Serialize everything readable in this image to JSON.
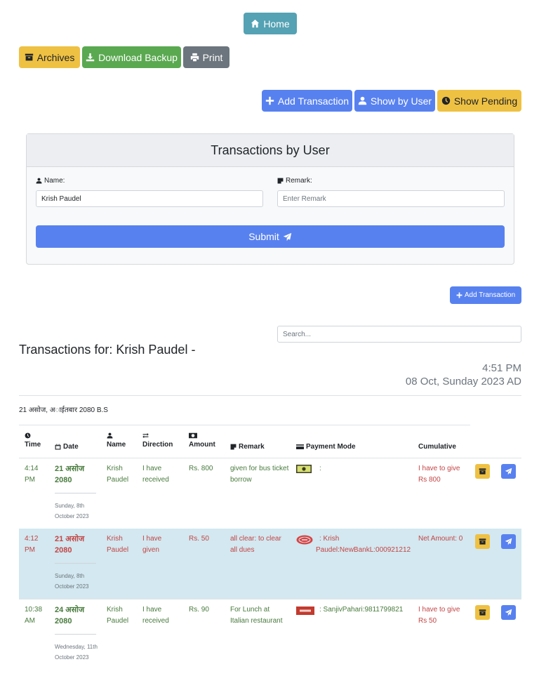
{
  "nav": {
    "home_label": "Home"
  },
  "toolbar": {
    "archives_label": "Archives",
    "download_label": "Download Backup",
    "print_label": "Print"
  },
  "actions": {
    "add_transaction_label": "Add Transaction",
    "show_by_user_label": "Show by User",
    "show_pending_label": "Show Pending"
  },
  "filter_form": {
    "title": "Transactions by User",
    "name_label": "Name:",
    "name_value": "Krish Paudel",
    "remark_label": "Remark:",
    "remark_placeholder": "Enter Remark",
    "submit_label": "Submit"
  },
  "small_add_transaction_label": "Add Transaction",
  "search": {
    "placeholder": "Search..."
  },
  "transactions_heading": "Transactions for: Krish Paudel -",
  "clock": {
    "time": "4:51 PM",
    "date": "08 Oct, Sunday 2023 AD"
  },
  "nepali_date": "21 असोज, अाईतबार 2080 B.S",
  "table": {
    "headers": {
      "time": "Time",
      "date": "Date",
      "name": "Name",
      "direction": "Direction",
      "amount": "Amount",
      "remark": "Remark",
      "payment_mode": "Payment Mode",
      "cumulative": "Cumulative"
    },
    "rows": [
      {
        "time": "4:14 PM",
        "date_np": "21 असोज 2080",
        "date_en": "Sunday, 8th October 2023",
        "name": "Krish Paudel",
        "direction": "I have received",
        "amount": "Rs. 800",
        "remark": "given for bus ticket borrow",
        "payment_mode": ":",
        "cumulative": "I have to give Rs 800",
        "payment_icon": "cash-icon",
        "color": "#477a3c"
      },
      {
        "time": "4:12 PM",
        "date_np": "21 असोज 2080",
        "date_en": "Sunday, 8th October 2023",
        "name": "Krish Paudel",
        "direction": "I have given",
        "amount": "Rs. 50",
        "remark": "all clear: to clear all dues",
        "payment_mode": ": Krish Paudel:NewBankL:000921212",
        "cumulative": "Net Amount: 0",
        "payment_icon": "bank-logo-icon",
        "color": "#c34545"
      },
      {
        "time": "10:38 AM",
        "date_np": "24 असोज 2080",
        "date_en": "Wednesday, 11th October 2023",
        "name": "Krish Paudel",
        "direction": "I have received",
        "amount": "Rs. 90",
        "remark": "For Lunch at Italian restaurant",
        "payment_mode": ": SanjivPahari:9811799821",
        "cumulative": "I have to give Rs 50",
        "payment_icon": "wallet-logo-icon",
        "color": "#477a3c"
      }
    ]
  },
  "colors": {
    "primary": "#5881f0",
    "info": "#54a2b3",
    "warning": "#efc143",
    "success": "#5aa950",
    "secondary": "#6c757d",
    "received": "#477a3c",
    "given": "#c34545",
    "row_highlight": "#d3e8f0"
  }
}
